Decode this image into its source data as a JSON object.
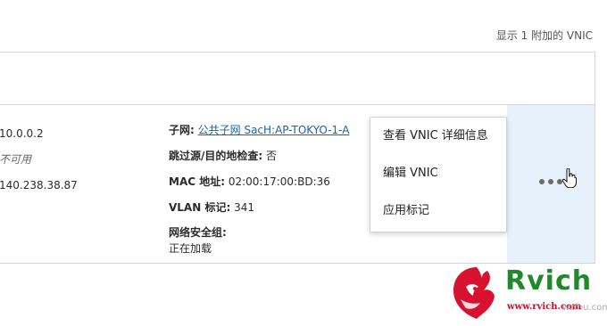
{
  "header": {
    "count_text": "显示 1 附加的 VNIC"
  },
  "row": {
    "col1": {
      "private_ip": "10.0.0.2",
      "status": "不可用",
      "public_ip": "140.238.38.87"
    },
    "col2": {
      "subnet_label": "子网:",
      "subnet_value": "公共子网 SacH:AP-TOKYO-1-A",
      "skip_check_label": "跳过源/目的地检查:",
      "skip_check_value": "否",
      "mac_label": "MAC 地址:",
      "mac_value": "02:00:17:00:BD:36",
      "vlan_label": "VLAN 标记:",
      "vlan_value": "341",
      "nsg_label": "网络安全组:",
      "nsg_value": "正在加载"
    }
  },
  "menu": {
    "items": [
      {
        "label": "查看 VNIC 详细信息"
      },
      {
        "label": "编辑 VNIC"
      },
      {
        "label": "应用标记"
      }
    ]
  },
  "icons": {
    "actions": "more-dots-icon",
    "cursor": "hand-pointer-icon"
  },
  "watermark": {
    "brand": "Rvich",
    "url": "www.rvich.com",
    "url2": "wzfou.com"
  },
  "colors": {
    "link": "#1b62a8",
    "action_cell": "#e7f1fb",
    "brand_green": "#1f8a2c",
    "brand_red": "#c8102e"
  }
}
